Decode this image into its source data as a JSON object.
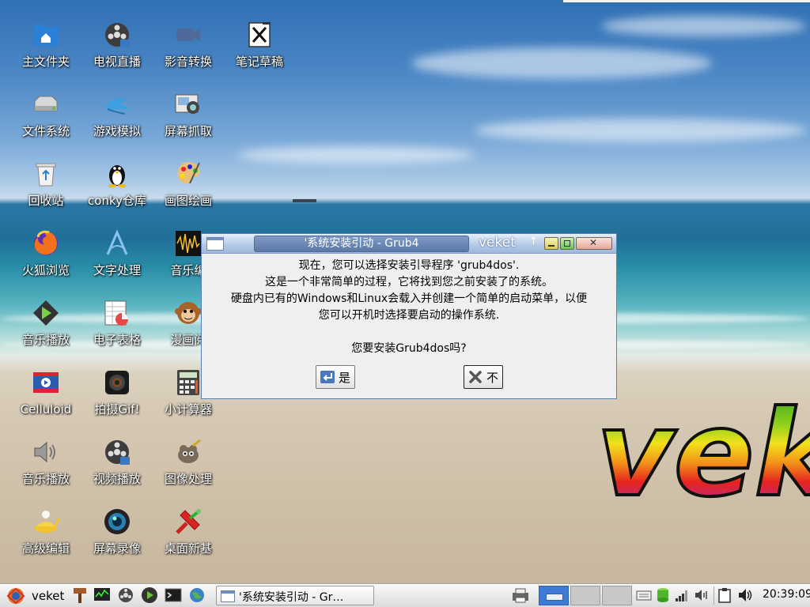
{
  "desktop": {
    "icons": [
      {
        "label": "主文件夹",
        "icon": "home-folder-icon"
      },
      {
        "label": "电视直播",
        "icon": "film-reel-icon"
      },
      {
        "label": "影音转换",
        "icon": "video-camera-icon"
      },
      {
        "label": "笔记草稿",
        "icon": "notepad-pen-icon"
      },
      {
        "label": "文件系统",
        "icon": "hard-drive-icon"
      },
      {
        "label": "游戏模拟",
        "icon": "dolphin-icon"
      },
      {
        "label": "屏幕抓取",
        "icon": "screenshot-camera-icon"
      },
      {
        "label": "回收站",
        "icon": "trash-icon"
      },
      {
        "label": "conky仓库",
        "icon": "penguin-icon"
      },
      {
        "label": "画图绘画",
        "icon": "paint-palette-icon"
      },
      {
        "label": "火狐浏览",
        "icon": "firefox-icon"
      },
      {
        "label": "文字处理",
        "icon": "abiword-icon"
      },
      {
        "label": "音乐编",
        "icon": "audio-waveform-icon"
      },
      {
        "label": "音乐播放",
        "icon": "play-circle-icon"
      },
      {
        "label": "电子表格",
        "icon": "spreadsheet-chart-icon"
      },
      {
        "label": "漫画阅",
        "icon": "monkey-icon"
      },
      {
        "label": "Celluloid",
        "icon": "video-player-icon"
      },
      {
        "label": "拍摄Gif!",
        "icon": "webcam-icon"
      },
      {
        "label": "小计算器",
        "icon": "calculator-icon"
      },
      {
        "label": "音乐播放",
        "icon": "speaker-icon"
      },
      {
        "label": "视频播放",
        "icon": "film-reel-icon"
      },
      {
        "label": "图像处理",
        "icon": "gimp-icon"
      },
      {
        "label": "高级编辑",
        "icon": "genie-lamp-icon"
      },
      {
        "label": "屏幕录像",
        "icon": "camera-lens-icon"
      },
      {
        "label": "桌面新基",
        "icon": "desktop-tools-icon"
      }
    ],
    "logo_text": "veke"
  },
  "dialog": {
    "title": "'系统安装引动 - Grub4",
    "brand": "veket",
    "lines": [
      "现在，您可以选择安装引导程序 'grub4dos'.",
      "这是一个非常简单的过程，它将找到您之前安装了的系统。",
      "硬盘内已有的Windows和Linux会载入并创建一个简单的启动菜单，以便",
      "您可以开机时选择要启动的操作系统.",
      "",
      "您要安装Grub4dos吗?"
    ],
    "yes_label": "是",
    "no_label": "不"
  },
  "taskbar": {
    "start_label": "veket",
    "task_label": "'系统安装引动 - Gr…",
    "clock": "20:39:09"
  },
  "colors": {
    "title_bar": "#b5cbe6",
    "dialog_bg": "#efefef",
    "pager_active": "#3d7bd6"
  }
}
